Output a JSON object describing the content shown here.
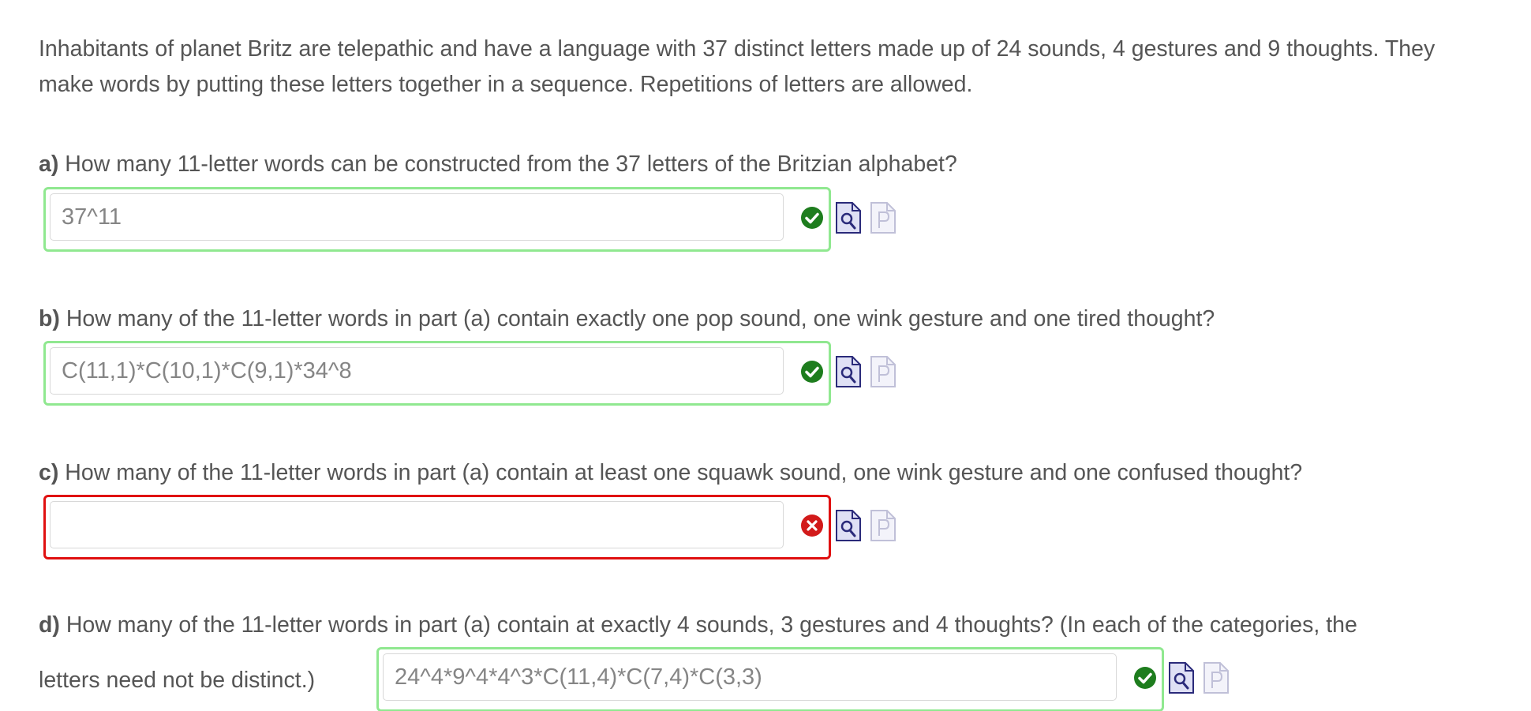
{
  "intro": {
    "text": "Inhabitants of planet Britz are telepathic and have a language with 37 distinct letters made up of 24 sounds, 4 gestures and 9 thoughts.  They make words by putting these letters together in a sequence.  Repetitions of letters are allowed."
  },
  "questions": [
    {
      "label": "a)",
      "text": "How many 11-letter words can be constructed from the 37 letters of the Britzian alphabet?",
      "answer": "37^11",
      "status": "correct",
      "status_icon": "check-circle-icon"
    },
    {
      "label": "b)",
      "text": "How many of the 11-letter words in part (a) contain exactly one pop sound, one wink gesture and one tired thought?",
      "answer": "C(11,1)*C(10,1)*C(9,1)*34^8",
      "status": "correct",
      "status_icon": "check-circle-icon"
    },
    {
      "label": "c)",
      "text": "How many of the 11-letter words in part (a) contain at least one squawk sound, one wink gesture and one confused thought?",
      "answer": "",
      "status": "incorrect",
      "status_icon": "x-circle-icon"
    },
    {
      "label": "d)",
      "text_line1": "How many of the 11-letter words in part (a) contain at exactly 4 sounds, 3 gestures and 4 thoughts?  (In each of the categories, the",
      "text_line2": "letters need not be distinct.)",
      "answer": "24^4*9^4*4^3*C(11,4)*C(7,4)*C(3,3)",
      "status": "correct",
      "status_icon": "check-circle-icon"
    }
  ],
  "colors": {
    "text": "#555555",
    "answer_text": "#858585",
    "correct_border": "#90e890",
    "incorrect_border": "#e01010",
    "correct_icon": "#1e7d1e",
    "incorrect_icon": "#d21a1a",
    "preview_icon": "#2a2a7a",
    "solution_icon_disabled": "#c0c0d8"
  },
  "icons": {
    "preview": "preview-magnifier-document-icon",
    "solution": "solution-p-document-icon"
  }
}
